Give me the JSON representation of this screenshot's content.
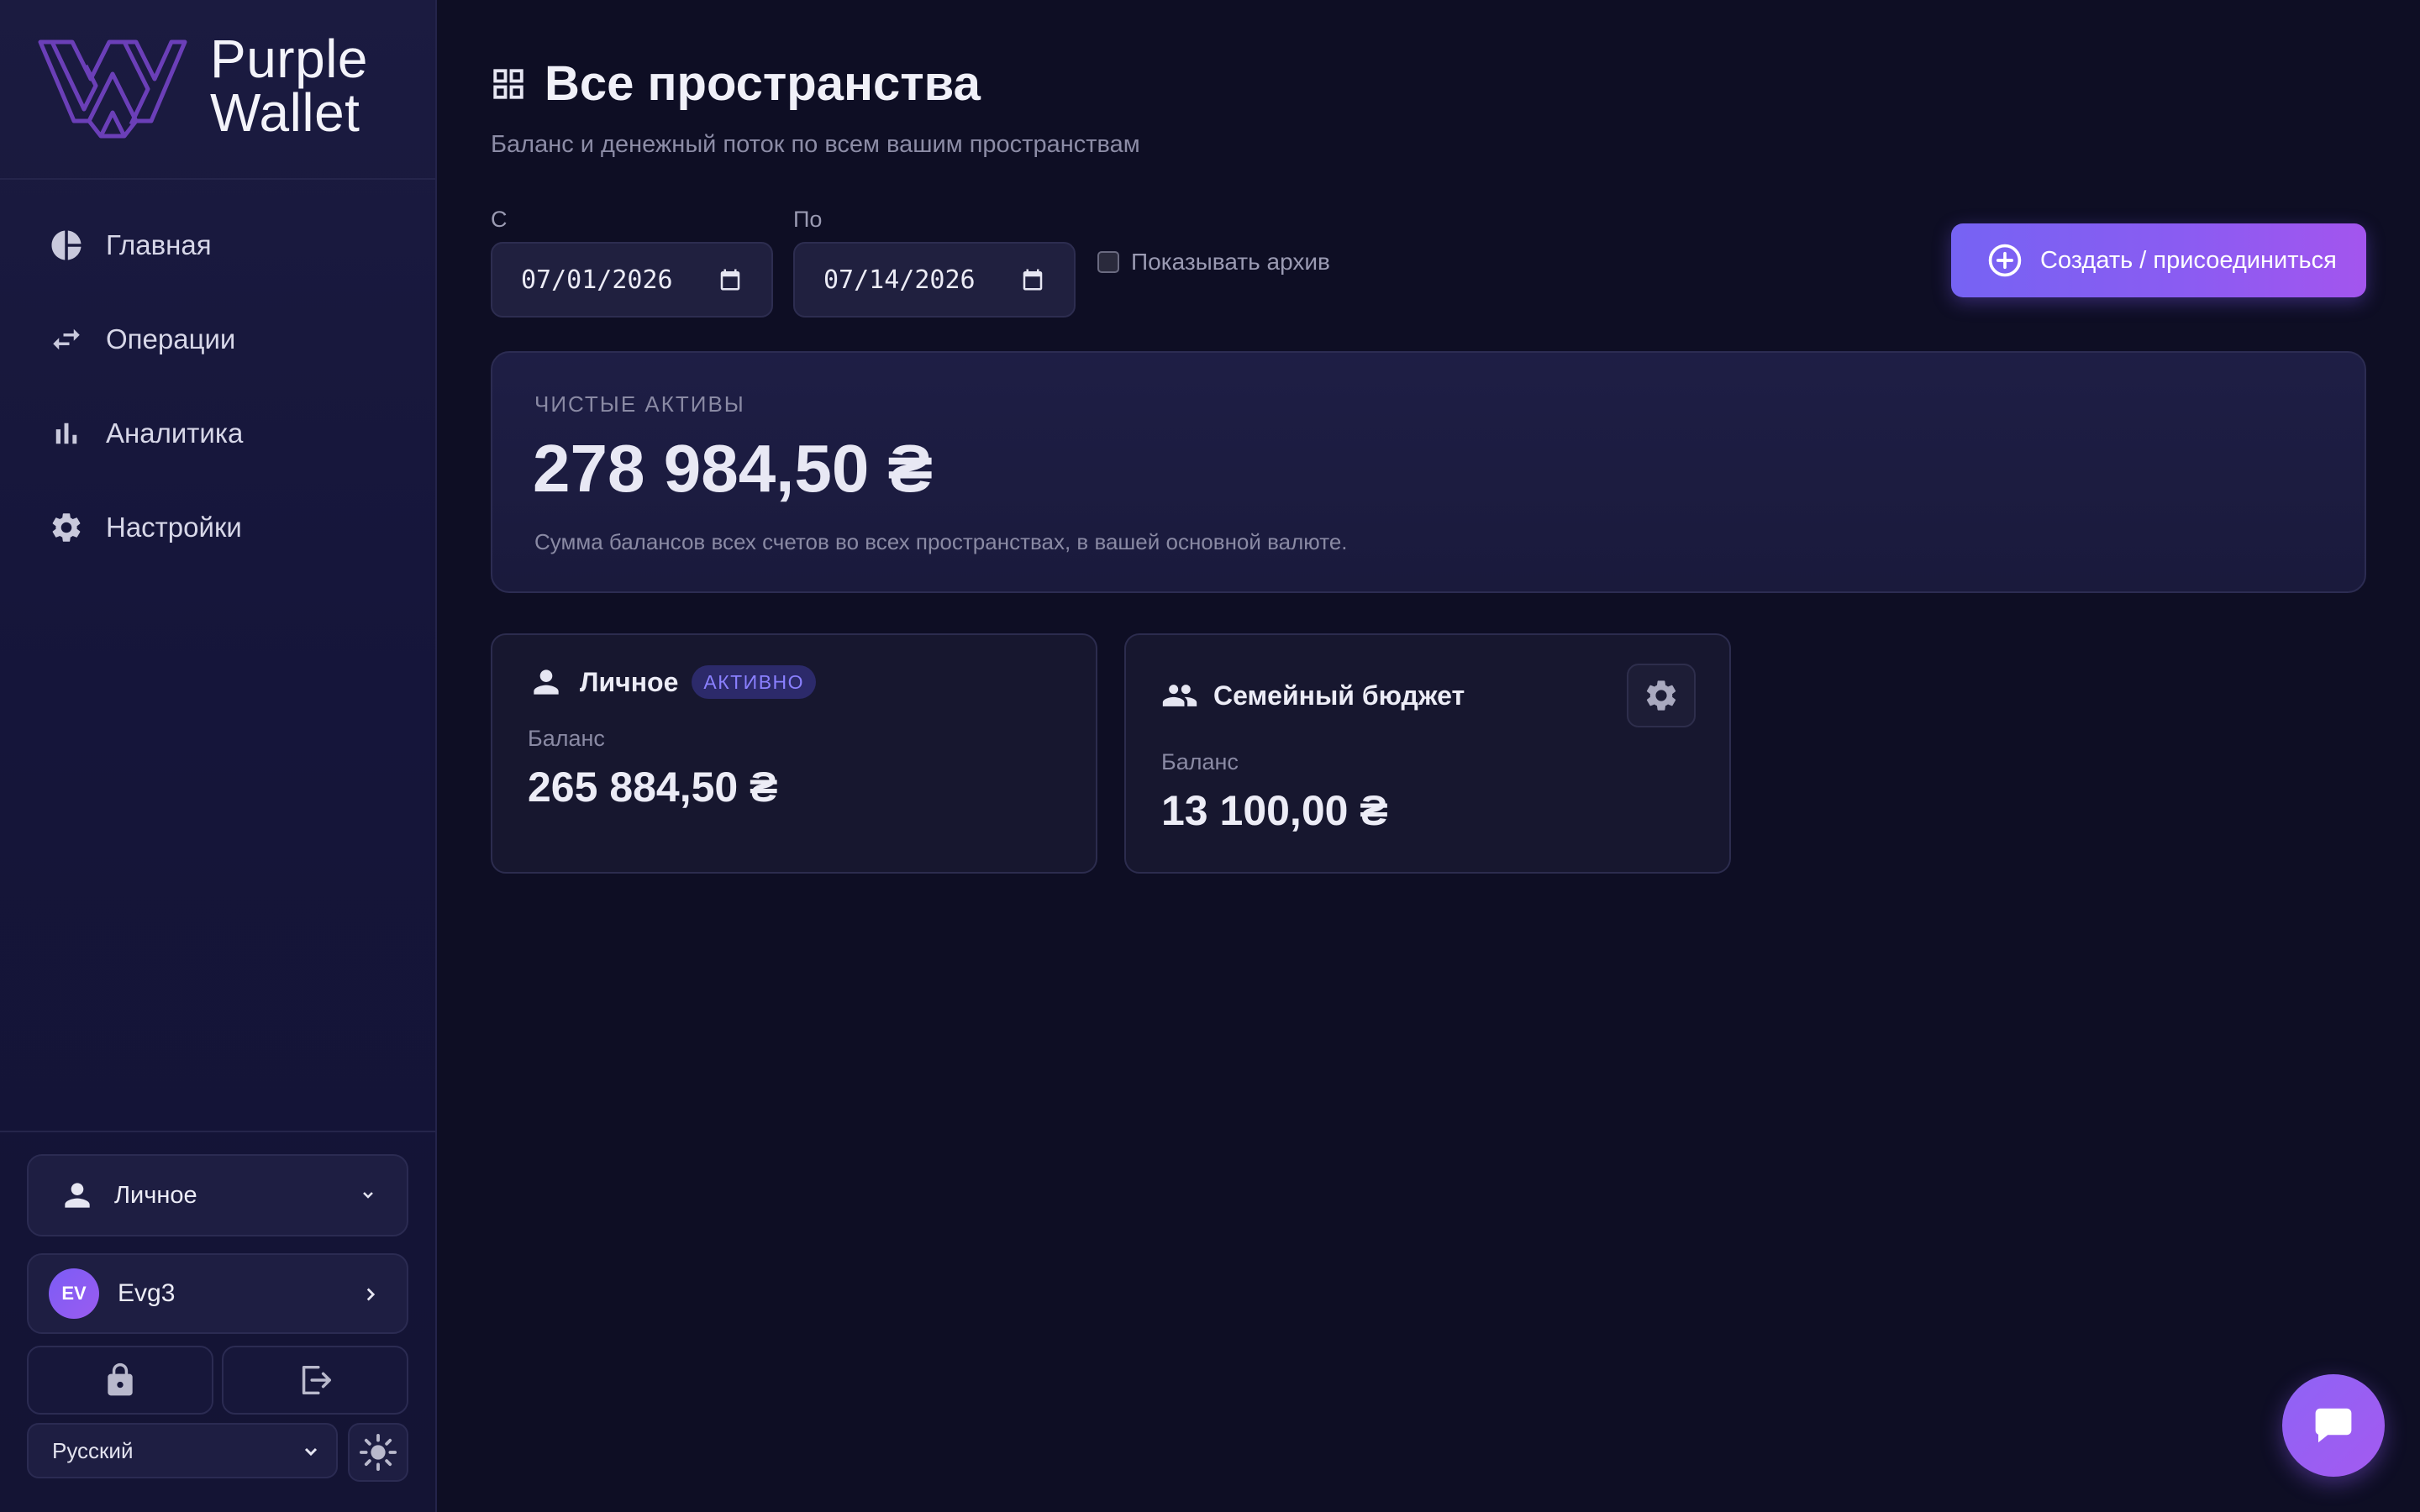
{
  "app": {
    "logo_line1": "Purple",
    "logo_line2": "Wallet",
    "brand_color": "#8b5cf6"
  },
  "sidebar": {
    "nav": [
      {
        "label": "Главная",
        "icon": "pie-chart-icon"
      },
      {
        "label": "Операции",
        "icon": "transfer-arrows-icon"
      },
      {
        "label": "Аналитика",
        "icon": "bar-chart-icon"
      },
      {
        "label": "Настройки",
        "icon": "gear-icon"
      }
    ],
    "space_selector": {
      "label": "Личное",
      "icon": "person-icon"
    },
    "user": {
      "initials": "EV",
      "name": "Evg3"
    },
    "language": "Русский"
  },
  "header": {
    "title": "Все пространства",
    "subtitle": "Баланс и денежный поток по всем вашим пространствам"
  },
  "filters": {
    "from_label": "С",
    "from_value": "07/01/2026",
    "to_label": "По",
    "to_value": "07/14/2026",
    "archive_label": "Показывать архив",
    "archive_checked": false
  },
  "create_button": {
    "label": "Создать / присоединиться"
  },
  "net_assets": {
    "caption": "ЧИСТЫЕ АКТИВЫ",
    "amount": "278 984,50 ₴",
    "description": "Сумма балансов всех счетов во всех пространствах, в вашей основной валюте."
  },
  "spaces": [
    {
      "name": "Личное",
      "badge": "АКТИВНО",
      "balance_label": "Баланс",
      "balance": "265 884,50 ₴",
      "icon": "person-icon"
    },
    {
      "name": "Семейный бюджет",
      "balance_label": "Баланс",
      "balance": "13 100,00 ₴",
      "icon": "group-icon"
    }
  ]
}
